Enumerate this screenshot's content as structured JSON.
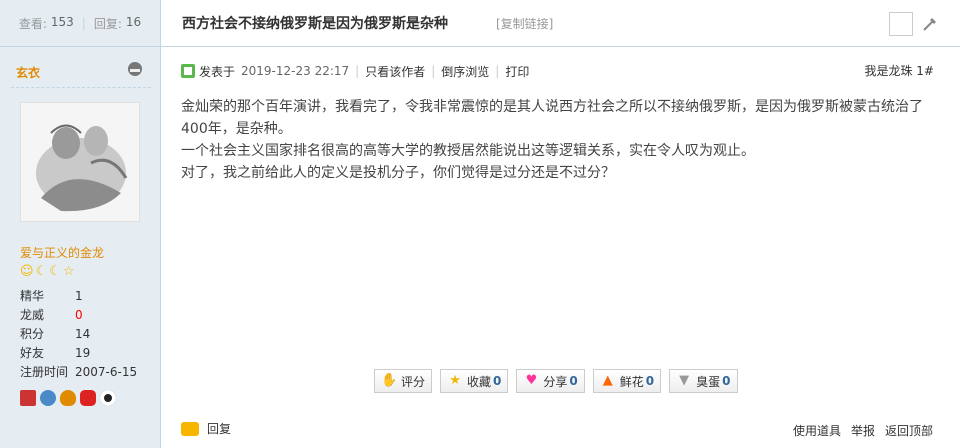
{
  "sidebar": {
    "views_label": "查看:",
    "views": "153",
    "replies_label": "回复:",
    "replies": "16",
    "username": "玄衣",
    "user_title": "爱与正义的金龙",
    "stars": [
      "☺",
      "☾",
      "☾",
      "☆"
    ],
    "info": [
      {
        "key": "精华",
        "value": "1"
      },
      {
        "key": "龙威",
        "value": "0"
      },
      {
        "key": "积分",
        "value": "14"
      },
      {
        "key": "好友",
        "value": "19"
      },
      {
        "key": "注册时间",
        "value": "2007-6-15"
      }
    ]
  },
  "topic": {
    "title": "西方社会不接纳俄罗斯是因为俄罗斯是杂种",
    "copy_link": "[复制链接]"
  },
  "post": {
    "posted_on_label": "发表于",
    "date": "2019-12-23 22:17",
    "only_author": "只看该作者",
    "reverse_browse": "倒序浏览",
    "print": "打印",
    "floor_prefix": "我是龙珠",
    "floor_num": "1#",
    "paragraphs": [
      "金灿荣的那个百年演讲，我看完了，令我非常震惊的是其人说西方社会之所以不接纳俄罗斯，是因为俄罗斯被蒙古统治了400年，是杂种。",
      "一个社会主义国家排名很高的高等大学的教授居然能说出这等逻辑关系，实在令人叹为观止。",
      "对了，我之前给此人的定义是投机分子，你们觉得是过分还是不过分？"
    ]
  },
  "actions": [
    {
      "name": "rate-button",
      "icon": "thumb-icon",
      "glyph": "👍",
      "label": "评分",
      "count": ""
    },
    {
      "name": "favorite-button",
      "icon": "star-icon",
      "glyph": "★",
      "label": "收藏",
      "count": "0"
    },
    {
      "name": "share-button",
      "icon": "heart-icon",
      "glyph": "♥",
      "label": "分享",
      "count": "0"
    },
    {
      "name": "flower-button",
      "icon": "up-arrow-icon",
      "glyph": "⬆",
      "label": "鲜花",
      "count": "0"
    },
    {
      "name": "egg-button",
      "icon": "down-arrow-icon",
      "glyph": "⬇",
      "label": "臭蛋",
      "count": "0"
    }
  ],
  "footer": {
    "reply": "回复",
    "use_tool": "使用道具",
    "report": "举报",
    "back_top": "返回顶部"
  }
}
